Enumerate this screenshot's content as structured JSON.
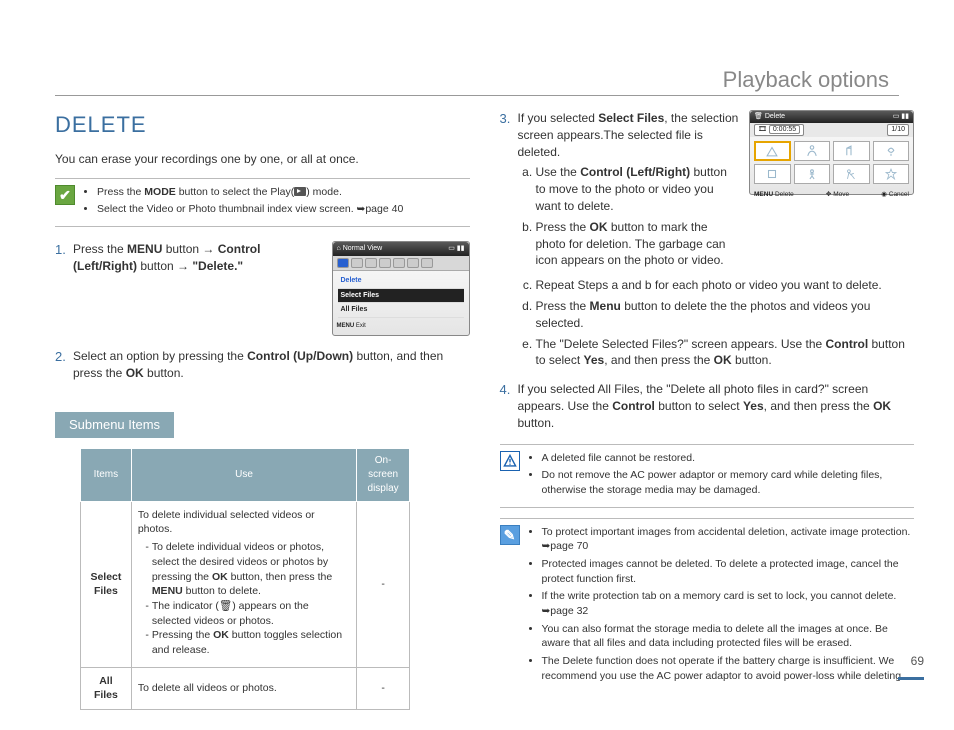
{
  "header": {
    "title": "Playback options"
  },
  "section": {
    "title": "DELETE",
    "intro": "You can erase your recordings one by one, or all at once."
  },
  "notebox": {
    "line1_a": "Press the ",
    "line1_b": "MODE",
    "line1_c": " button to select the Play(",
    "line1_d": ") mode.",
    "line2": "Select the Video or Photo thumbnail index view screen. ➥page 40"
  },
  "steps_left": {
    "s1_a": "Press the ",
    "s1_b": "MENU",
    "s1_c": " button ",
    "s1_d": "Control (Left/Right)",
    "s1_e": " button ",
    "s1_f": "\"Delete.\"",
    "s2_a": "Select an option by pressing the ",
    "s2_b": "Control (Up/Down)",
    "s2_c": " button, and then press the ",
    "s2_d": "OK",
    "s2_e": " button."
  },
  "mock1": {
    "title": "Normal View",
    "delete": "Delete",
    "select": "Select Files",
    "all": "All Files",
    "menu": "MENU",
    "exit": "Exit"
  },
  "submenu": {
    "heading": "Submenu Items",
    "th1": "Items",
    "th2": "Use",
    "th3": "On-screen display",
    "row1_item": "Select Files",
    "row1_use_intro": "To delete individual selected videos or photos.",
    "row1_use_b1_a": "To delete individual videos or photos, select the desired videos or photos by pressing the ",
    "row1_use_b1_b": "OK",
    "row1_use_b1_c": " button, then press the ",
    "row1_use_b1_d": "MENU",
    "row1_use_b1_e": " button to delete.",
    "row1_use_b2": "The indicator (🗑) appears on the selected videos or photos.",
    "row1_use_b3_a": "Pressing the ",
    "row1_use_b3_b": "OK",
    "row1_use_b3_c": " button toggles selection and release.",
    "row1_disp": "-",
    "row2_item": "All Files",
    "row2_use": "To delete all videos or photos.",
    "row2_disp": "-"
  },
  "steps_right": {
    "s3_a": "If you selected ",
    "s3_b": "Select Files",
    "s3_c": ", the selection screen appears.The selected file is deleted.",
    "s3a_a": "Use the ",
    "s3a_b": "Control (Left/Right)",
    "s3a_c": " button to move to the photo or video you want to delete.",
    "s3b_a": "Press the ",
    "s3b_b": "OK",
    "s3b_c": " button to mark the photo for deletion. The garbage can icon appears on the photo or video.",
    "s3c": "Repeat Steps a and b for each photo or video you want to delete.",
    "s3d_a": "Press the ",
    "s3d_b": "Menu",
    "s3d_c": " button to delete the the photos and videos you selected.",
    "s3e_a": "The \"Delete Selected Files?\" screen appears. Use the ",
    "s3e_b": "Control",
    "s3e_c": " button to select ",
    "s3e_d": "Yes",
    "s3e_e": ", and then press the ",
    "s3e_f": "OK",
    "s3e_g": " button.",
    "s4_a": "If you selected All Files, the \"Delete all photo files in card?\" screen appears. Use the ",
    "s4_b": "Control",
    "s4_c": " button to select ",
    "s4_d": "Yes",
    "s4_e": ", and then press the ",
    "s4_f": "OK",
    "s4_g": " button."
  },
  "mock2": {
    "title": "Delete",
    "counter": "0:00:55",
    "page": "1/10",
    "menu": "MENU",
    "delete": "Delete",
    "move": "Move",
    "cancel": "Cancel"
  },
  "warn": {
    "b1": "A deleted file cannot be restored.",
    "b2": "Do not remove the AC power adaptor or memory card while deleting files, otherwise the storage media may be damaged."
  },
  "info": {
    "b1": "To protect important images from accidental deletion, activate image protection. ➥page 70",
    "b2": "Protected images cannot be deleted. To delete a protected image, cancel the protect function first.",
    "b3": "If the write protection tab on a memory card is set to lock, you cannot delete. ➥page 32",
    "b4": "You can also format the storage media to delete all the images at once. Be aware that all files and data including protected files will be erased.",
    "b5": "The Delete function does not operate if the battery charge is insufficient. We recommend you use the AC power adaptor to avoid power-loss while deleting."
  },
  "pagenum": "69"
}
